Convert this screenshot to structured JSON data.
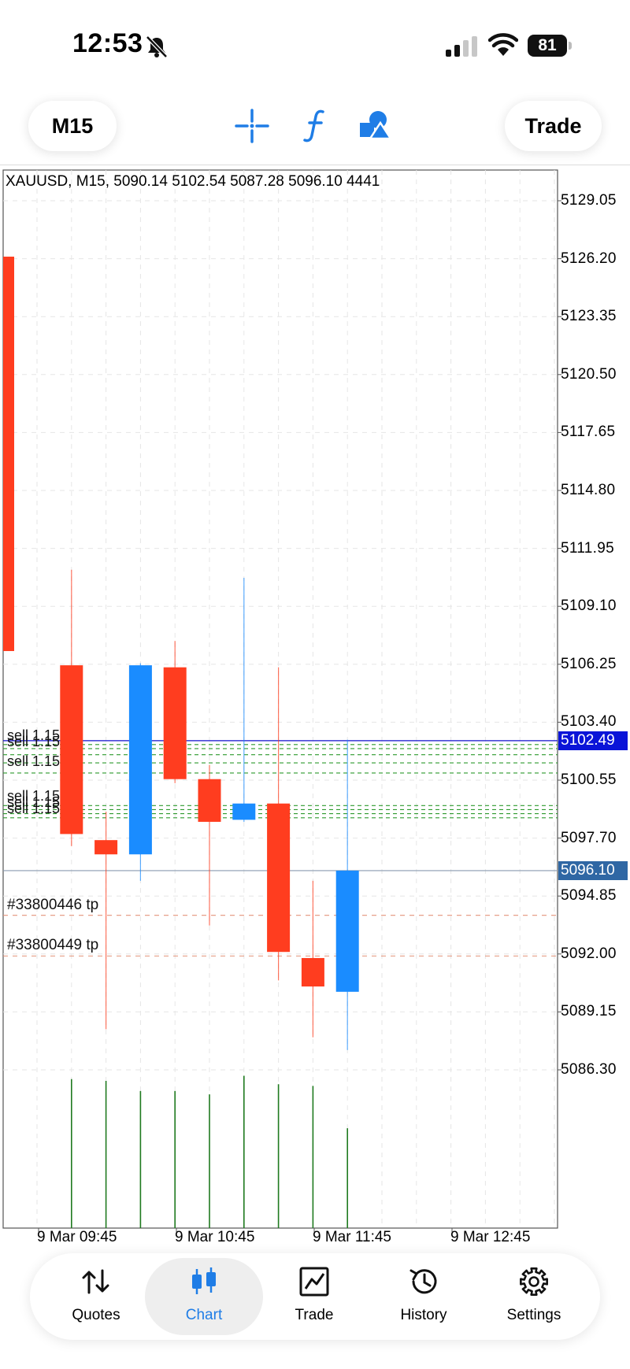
{
  "status_bar": {
    "time": "12:53",
    "battery": "81"
  },
  "toolbar": {
    "timeframe_label": "M15",
    "trade_label": "Trade",
    "icons": [
      "crosshair-icon",
      "function-icon",
      "objects-icon"
    ]
  },
  "chart": {
    "info": "XAUUSD, M15, 5090.14 5102.54 5087.28 5096.10 4441",
    "bid_tag": "5102.49",
    "last_tag": "5096.10",
    "y_labels": [
      "5129.05",
      "5126.20",
      "5123.35",
      "5120.50",
      "5117.65",
      "5114.80",
      "5111.95",
      "5109.10",
      "5106.25",
      "5103.40",
      "5100.55",
      "5097.70",
      "5094.85",
      "5092.00",
      "5089.15",
      "5086.30"
    ],
    "x_labels": [
      "9 Mar 09:45",
      "9 Mar 10:45",
      "9 Mar 11:45",
      "9 Mar 12:45"
    ],
    "order_labels": [
      "sell 1.15",
      "sell 1.15",
      "sell 1.15",
      "sell 1.15",
      "sell 1.15",
      "sell 1.15"
    ],
    "tp_labels": [
      "#33800446 tp",
      "#33800449 tp"
    ],
    "colors": {
      "bear": "#ff3d1f",
      "bull": "#1a8cff",
      "volume": "#1f7a1f",
      "bid_line": "#1111cc",
      "bid_tag": "#0a14d8",
      "last_tag": "#2f67a4"
    }
  },
  "chart_data": {
    "type": "candlestick",
    "symbol": "XAUUSD",
    "timeframe": "M15",
    "ylim": [
      5083.45,
      5131.9
    ],
    "candles": [
      {
        "open": 5126.3,
        "high": 5126.3,
        "low": 5106.9,
        "close": 5106.9
      },
      {
        "open": 5106.2,
        "high": 5110.9,
        "low": 5097.3,
        "close": 5097.9
      },
      {
        "open": 5097.6,
        "high": 5099.0,
        "low": 5088.3,
        "close": 5096.9
      },
      {
        "open": 5096.9,
        "high": 5106.3,
        "low": 5095.6,
        "close": 5106.2
      },
      {
        "open": 5106.1,
        "high": 5107.4,
        "low": 5100.4,
        "close": 5100.6
      },
      {
        "open": 5100.6,
        "high": 5101.3,
        "low": 5093.4,
        "close": 5098.5
      },
      {
        "open": 5098.6,
        "high": 5110.5,
        "low": 5098.5,
        "close": 5099.4
      },
      {
        "open": 5099.4,
        "high": 5106.1,
        "low": 5090.7,
        "close": 5092.1
      },
      {
        "open": 5091.8,
        "high": 5095.6,
        "low": 5087.9,
        "close": 5090.4
      },
      {
        "open": 5090.14,
        "high": 5102.54,
        "low": 5087.28,
        "close": 5096.1
      }
    ],
    "volume": [
      0,
      4400,
      4350,
      4050,
      4050,
      3950,
      4500,
      4250,
      4200,
      2950
    ],
    "bid": 5102.49,
    "last": 5096.1,
    "order_lines": [
      5102.3,
      5102.1,
      5101.8,
      5101.4,
      5100.9,
      5099.3,
      5099.1,
      5098.9,
      5098.7
    ],
    "tp_lines": [
      5093.9,
      5091.9
    ]
  },
  "bottom_nav": [
    {
      "label": "Quotes",
      "icon": "quotes-icon",
      "active": false
    },
    {
      "label": "Chart",
      "icon": "chart-icon",
      "active": true
    },
    {
      "label": "Trade",
      "icon": "trade-icon",
      "active": false
    },
    {
      "label": "History",
      "icon": "history-icon",
      "active": false
    },
    {
      "label": "Settings",
      "icon": "settings-icon",
      "active": false
    }
  ]
}
